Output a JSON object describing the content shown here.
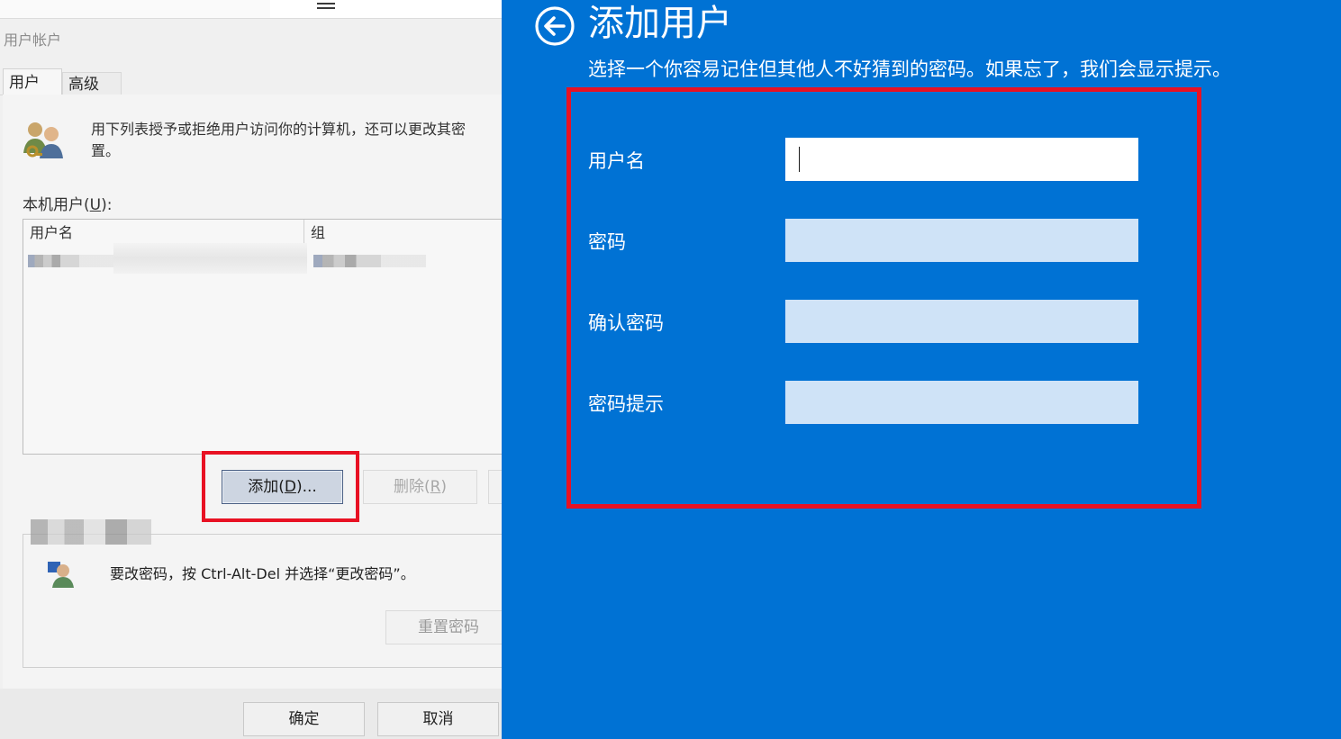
{
  "legacy_dialog": {
    "window_title": "用户帐户",
    "tabs": [
      {
        "label": "用户",
        "active": true
      },
      {
        "label": "高级",
        "active": false
      }
    ],
    "description_line1": "用下列表授予或拒绝用户访问你的计算机，还可以更改其密",
    "description_line2": "置。",
    "local_users_label_prefix": "本机用户(",
    "local_users_label_key": "U",
    "local_users_label_suffix": "):",
    "columns": [
      "用户名",
      "组"
    ],
    "buttons": {
      "add_prefix": "添加(",
      "add_key": "D",
      "add_suffix": ")...",
      "remove_prefix": "删除(",
      "remove_key": "R",
      "remove_suffix": ")",
      "reset_password": "重置密码",
      "ok": "确定",
      "cancel": "取消"
    },
    "password_hint_text": "要改密码，按 Ctrl-Alt-Del 并选择“更改密码”。"
  },
  "add_user_pane": {
    "title": "添加用户",
    "subtitle": "选择一个你容易记住但其他人不好猜到的密码。如果忘了，我们会显示提示。",
    "fields": [
      {
        "label": "用户名",
        "value": "",
        "focused": true
      },
      {
        "label": "密码",
        "value": "",
        "focused": false
      },
      {
        "label": "确认密码",
        "value": "",
        "focused": false
      },
      {
        "label": "密码提示",
        "value": "",
        "focused": false
      }
    ]
  },
  "colors": {
    "accent_blue": "#0072d4",
    "highlight_red": "#e81123",
    "input_fill": "#cfe3f7"
  },
  "icons": [
    "menu-icon",
    "users-icon",
    "user-password-icon",
    "back-arrow-icon"
  ]
}
